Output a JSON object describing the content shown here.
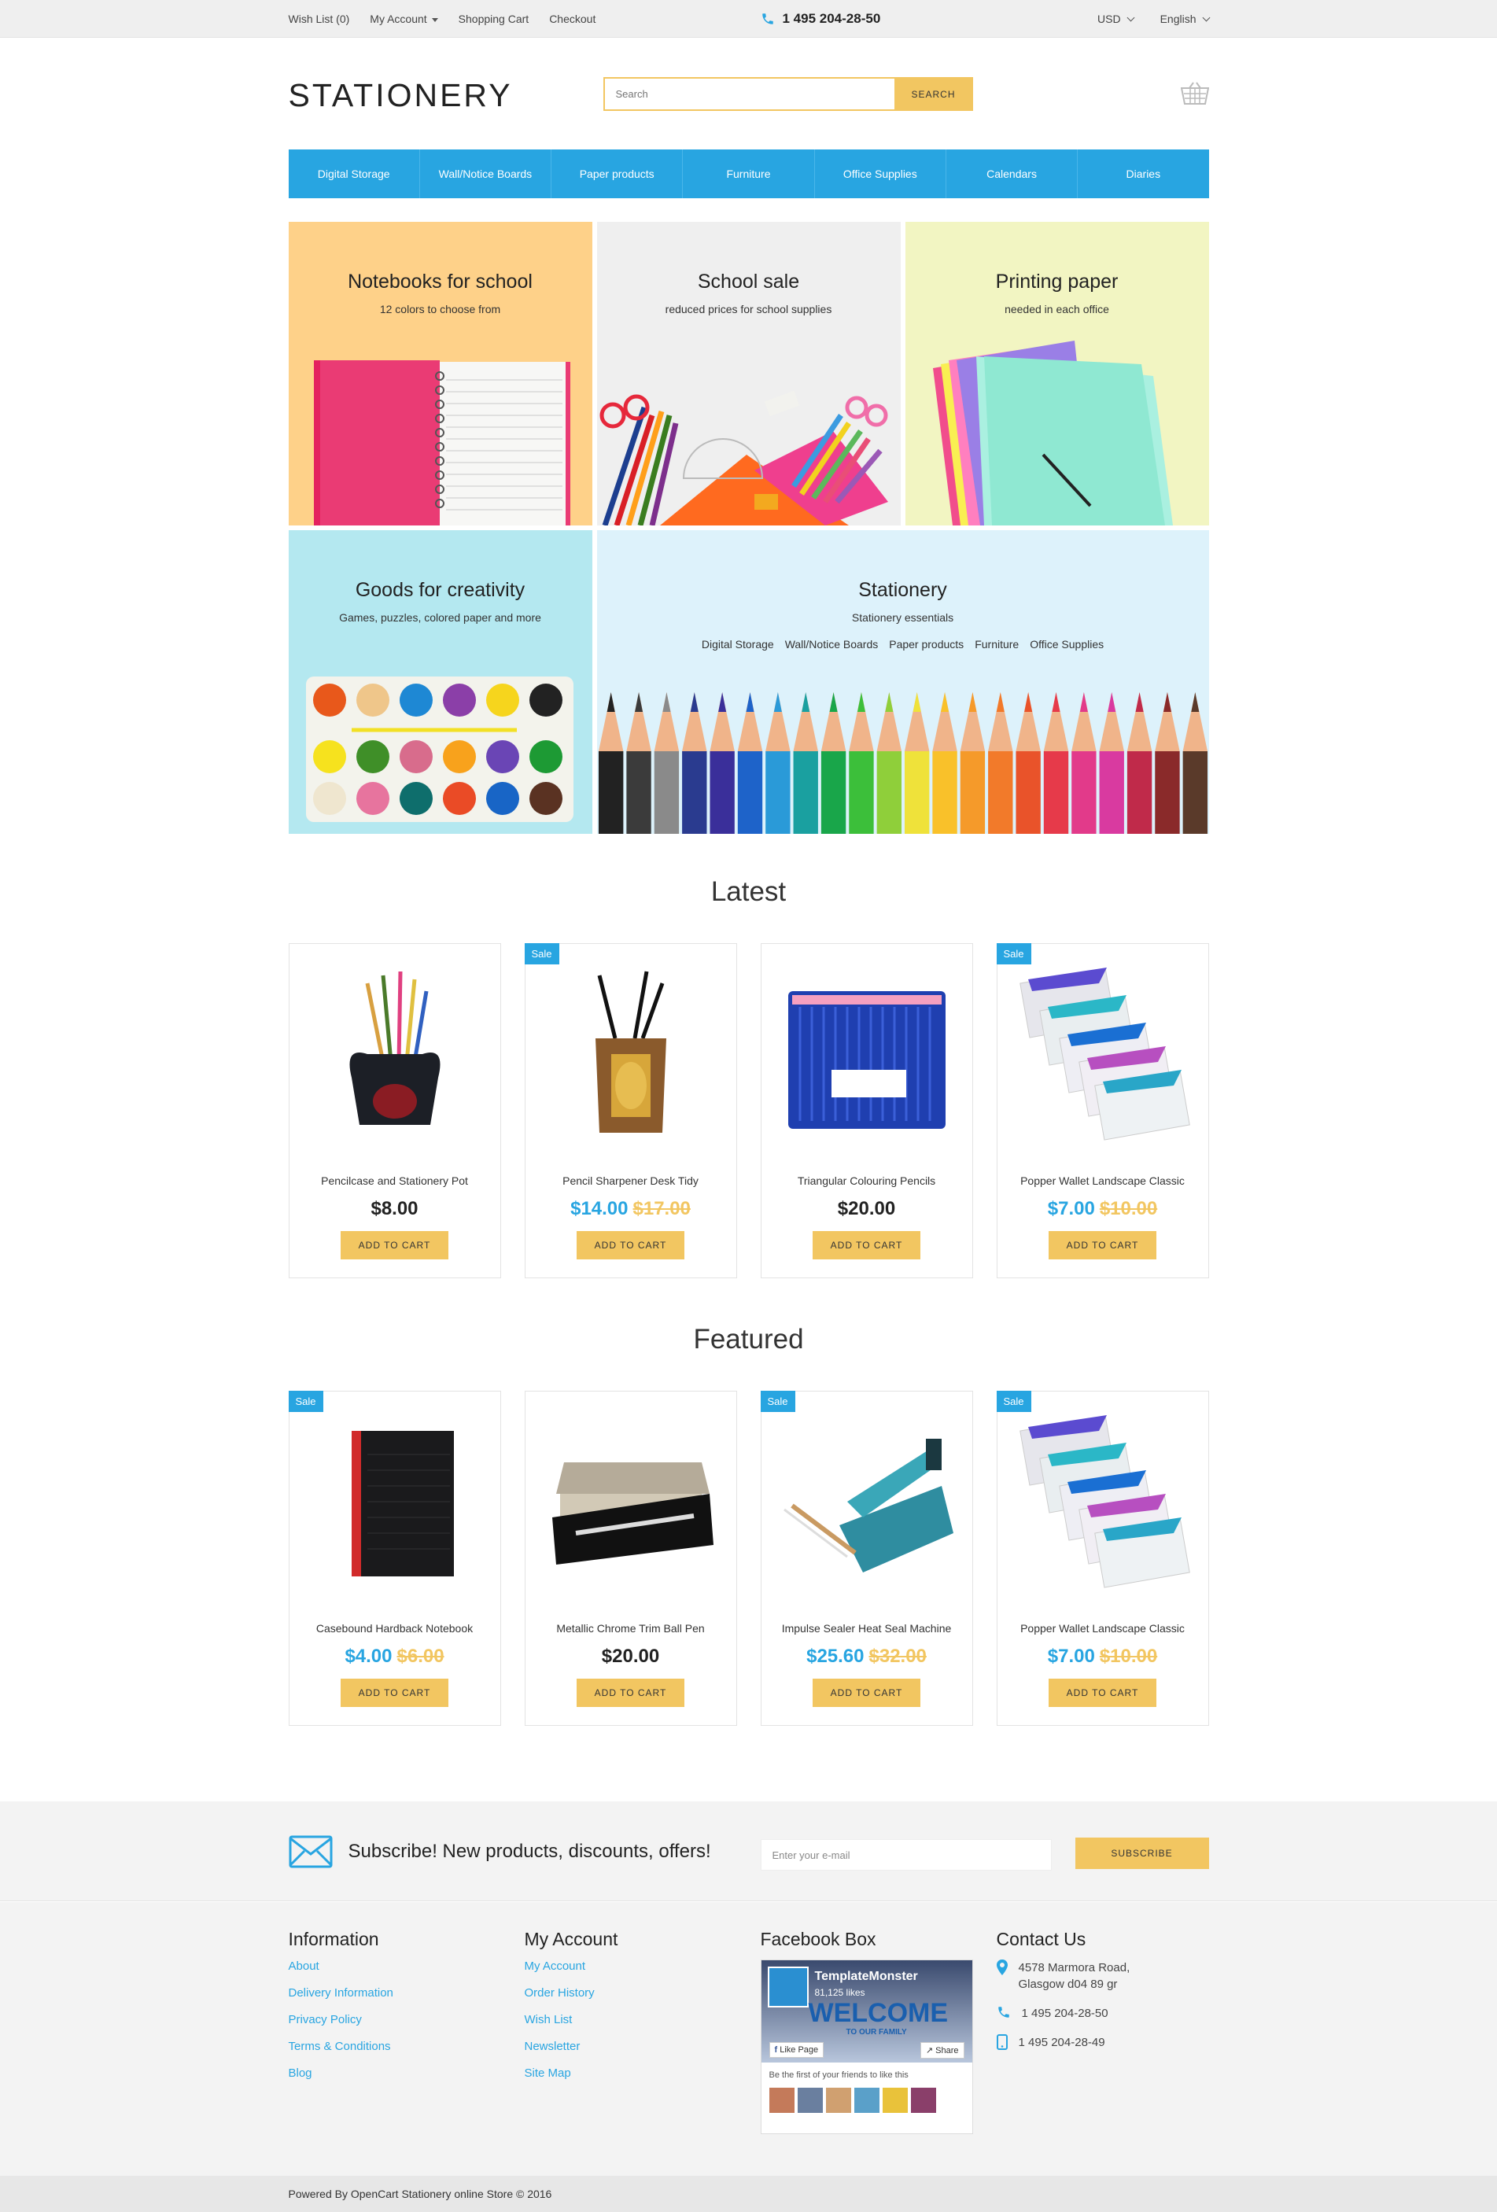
{
  "topbar": {
    "links": [
      "Wish List (0)",
      "My Account",
      "Shopping Cart",
      "Checkout"
    ],
    "phone": "1 495 204-28-50",
    "currency": "USD",
    "language": "English"
  },
  "header": {
    "logo": "STATIONERY",
    "search_placeholder": "Search",
    "search_button": "SEARCH"
  },
  "nav": [
    "Digital Storage",
    "Wall/Notice Boards",
    "Paper products",
    "Furniture",
    "Office Supplies",
    "Calendars",
    "Diaries"
  ],
  "banners": [
    {
      "title": "Notebooks for school",
      "subtitle": "12 colors to choose from"
    },
    {
      "title": "School sale",
      "subtitle": "reduced prices for school supplies"
    },
    {
      "title": "Printing paper",
      "subtitle": "needed in each office"
    },
    {
      "title": "Goods for creativity",
      "subtitle": "Games, puzzles, colored paper and more"
    },
    {
      "title": "Stationery",
      "subtitle": "Stationery essentials",
      "links": [
        "Digital Storage",
        "Wall/Notice Boards",
        "Paper products",
        "Furniture",
        "Office Supplies"
      ]
    }
  ],
  "latest": {
    "title": "Latest",
    "products": [
      {
        "name": "Pencilcase and Stationery Pot",
        "price": "$8.00",
        "old": "",
        "sale": ""
      },
      {
        "name": "Pencil Sharpener Desk Tidy",
        "price": "$14.00",
        "old": "$17.00",
        "sale": "Sale"
      },
      {
        "name": "Triangular Colouring Pencils",
        "price": "$20.00",
        "old": "",
        "sale": ""
      },
      {
        "name": "Popper Wallet Landscape Classic",
        "price": "$7.00",
        "old": "$10.00",
        "sale": "Sale"
      }
    ]
  },
  "featured": {
    "title": "Featured",
    "products": [
      {
        "name": "Casebound Hardback Notebook",
        "price": "$4.00",
        "old": "$6.00",
        "sale": "Sale"
      },
      {
        "name": "Metallic Chrome Trim Ball Pen",
        "price": "$20.00",
        "old": "",
        "sale": ""
      },
      {
        "name": "Impulse Sealer Heat Seal Machine",
        "price": "$25.60",
        "old": "$32.00",
        "sale": "Sale"
      },
      {
        "name": "Popper Wallet Landscape Classic",
        "price": "$7.00",
        "old": "$10.00",
        "sale": "Sale"
      }
    ]
  },
  "add_to_cart": "ADD TO CART",
  "newsletter": {
    "text": "Subscribe! New products, discounts, offers!",
    "placeholder": "Enter your e-mail",
    "button": "SUBSCRIBE"
  },
  "footer": {
    "information": {
      "title": "Information",
      "links": [
        "About",
        "Delivery Information",
        "Privacy Policy",
        "Terms & Conditions",
        "Blog"
      ]
    },
    "account": {
      "title": "My Account",
      "links": [
        "My Account",
        "Order History",
        "Wish List",
        "Newsletter",
        "Site Map"
      ]
    },
    "facebook": {
      "title": "Facebook Box",
      "page_name": "TemplateMonster",
      "likes": "81,125 likes",
      "welcome": "WELCOME",
      "family": "TO OUR FAMILY",
      "like_page": "Like Page",
      "share": "Share",
      "friends_text": "Be the first of your friends to like this"
    },
    "contact": {
      "title": "Contact Us",
      "address": "4578 Marmora Road, Glasgow d04 89 gr",
      "phone1": "1 495 204-28-50",
      "phone2": "1 495 204-28-49"
    }
  },
  "copyright": "Powered By OpenCart Stationery online Store © 2016",
  "colors": {
    "accent": "#28a5e1",
    "yellow": "#f2c661"
  }
}
